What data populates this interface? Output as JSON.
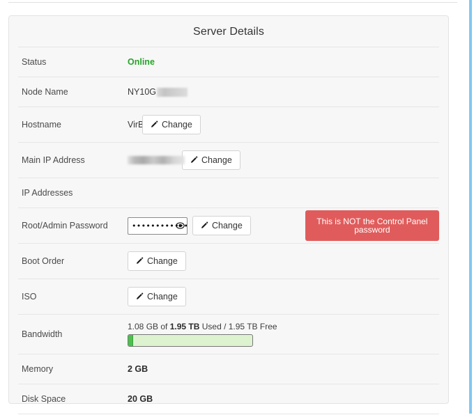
{
  "panel": {
    "title": "Server Details"
  },
  "rows": {
    "status": {
      "label": "Status",
      "value": "Online",
      "color": "#27a32b"
    },
    "node_name": {
      "label": "Node Name",
      "value": "NY10G"
    },
    "hostname": {
      "label": "Hostname",
      "value": "VirBF",
      "button": "Change"
    },
    "main_ip": {
      "label": "Main IP Address",
      "value": "",
      "button": "Change"
    },
    "ip_addresses": {
      "label": "IP Addresses",
      "value": ""
    },
    "root_password": {
      "label": "Root/Admin Password",
      "value": "••••••••••••••••",
      "button": "Change",
      "warning": "This is NOT the Control Panel password",
      "warning_color": "#e05c5c"
    },
    "boot_order": {
      "label": "Boot Order",
      "button": "Change"
    },
    "iso": {
      "label": "ISO",
      "button": "Change"
    },
    "bandwidth": {
      "label": "Bandwidth",
      "used_prefix": "1.08 GB of ",
      "total": "1.95 TB",
      "used_suffix": " Used / 1.95 TB Free",
      "percent": 4
    },
    "memory": {
      "label": "Memory",
      "value": "2 GB"
    },
    "disk_space": {
      "label": "Disk Space",
      "value": "20 GB"
    }
  }
}
